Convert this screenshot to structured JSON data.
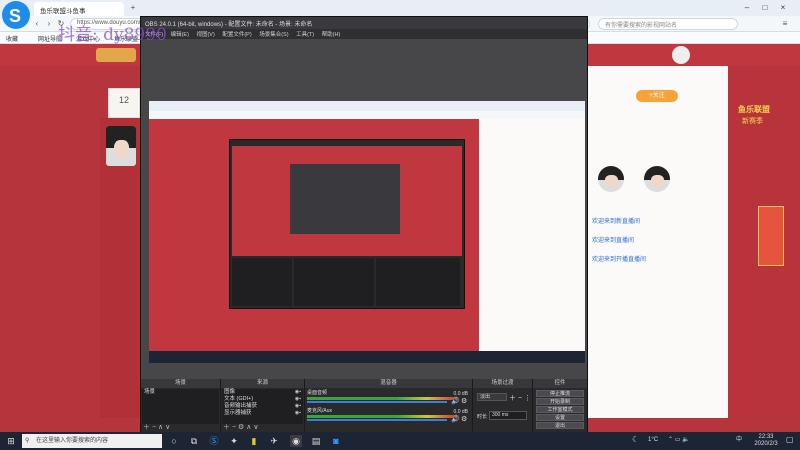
{
  "browser": {
    "tab_title": "鱼乐联盟斗鱼事",
    "address": "https://www.douyu.com/...",
    "search_placeholder": "有你需要搜索的影视网站名",
    "bookmarks": [
      "收藏",
      "网址导航",
      "游戏中心",
      "鱼乐联盟"
    ]
  },
  "page": {
    "badge_num": "12",
    "ad_title": "鱼乐联盟",
    "ad_sub": "新赛季",
    "follow_button": "+关注",
    "side_links": [
      "欢迎来到新直播间",
      "欢迎来到直播间",
      "欢迎来到开播直播间"
    ]
  },
  "watermark": "抖音: dy8990",
  "obs": {
    "title": "OBS 24.0.1 (64-bit, windows) - 配置文件: 未命名 - 场景: 未命名",
    "menu": [
      "文件(F)",
      "编辑(E)",
      "视图(V)",
      "配置文件(P)",
      "场景集合(S)",
      "工具(T)",
      "帮助(H)"
    ],
    "docks": {
      "scenes": {
        "title": "场景",
        "items": [
          "场景"
        ]
      },
      "sources": {
        "title": "来源",
        "items": [
          "图像",
          "文本 (GDI+)",
          "音频输出捕获",
          "显示器捕获"
        ]
      },
      "mixer": {
        "title": "混音器",
        "channels": [
          {
            "name": "桌面音频",
            "level": "0.0 dB"
          },
          {
            "name": "麦克风/Aux",
            "level": "0.0 dB"
          }
        ]
      },
      "transitions": {
        "title": "场景过渡",
        "mode": "淡出",
        "duration_label": "时长",
        "duration": "300 ms"
      },
      "controls": {
        "title": "控件",
        "buttons": [
          "停止推流",
          "开始录制",
          "工作室模式",
          "设置",
          "退出"
        ]
      }
    }
  },
  "taskbar": {
    "search_placeholder": "在这里输入你要搜索的内容",
    "time": "22:33",
    "date": "2020/2/3",
    "weather": "1°C",
    "ime": "中"
  }
}
